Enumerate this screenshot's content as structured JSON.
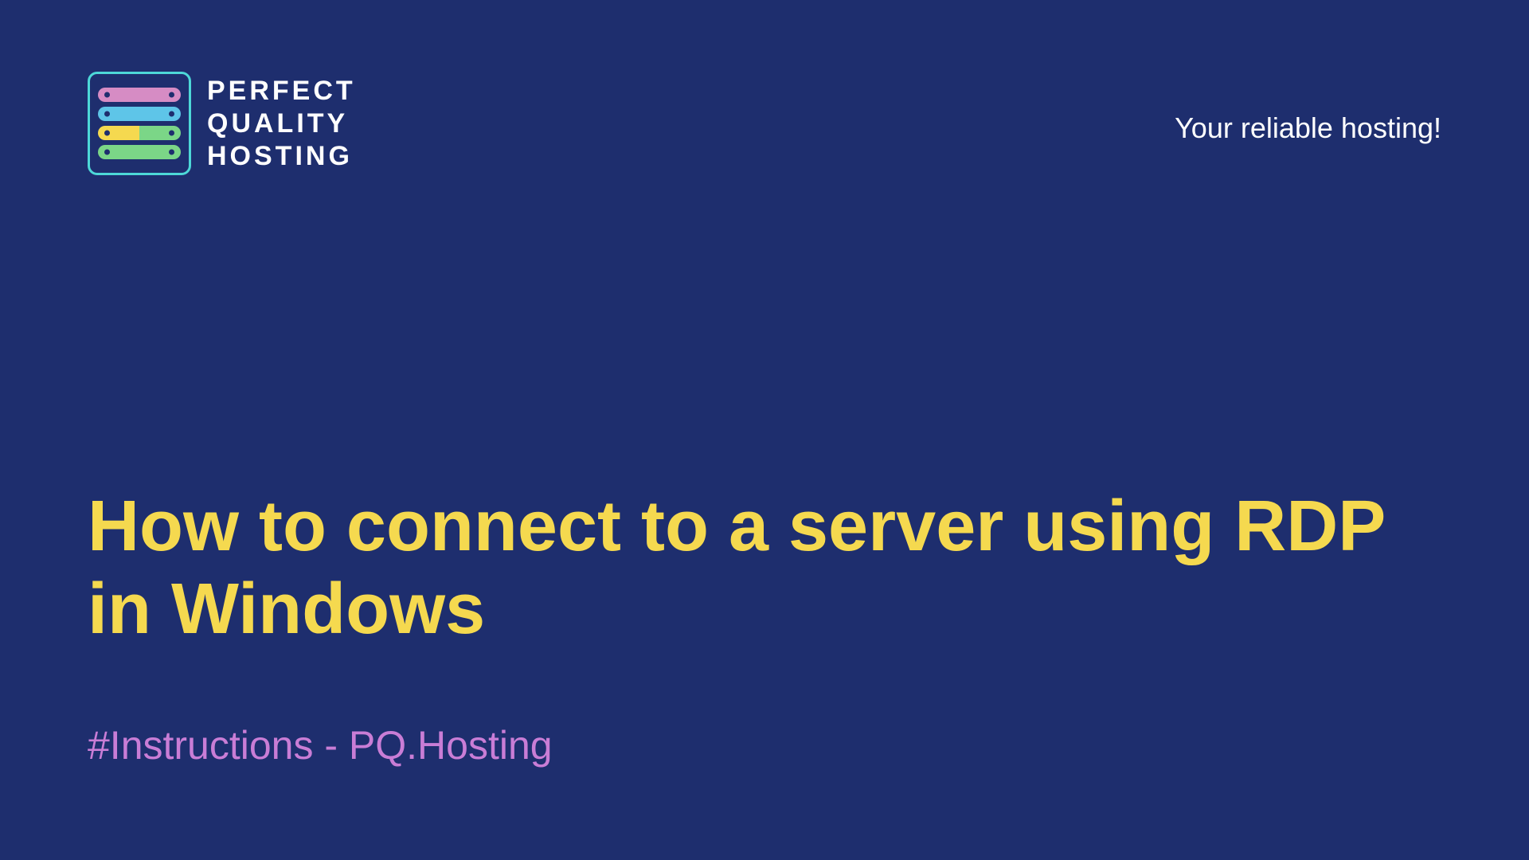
{
  "logo": {
    "word1": "PERFECT",
    "word2": "QUALITY",
    "word3": "HOSTING"
  },
  "tagline": "Your reliable hosting!",
  "title": "How to connect to a server using RDP in Windows",
  "subtitle": "#Instructions - PQ.Hosting",
  "colors": {
    "background": "#1e2e6e",
    "title": "#f5d94f",
    "subtitle": "#c97dd6",
    "logoText": "#ffffff",
    "logoBorder": "#4dd8d8"
  }
}
